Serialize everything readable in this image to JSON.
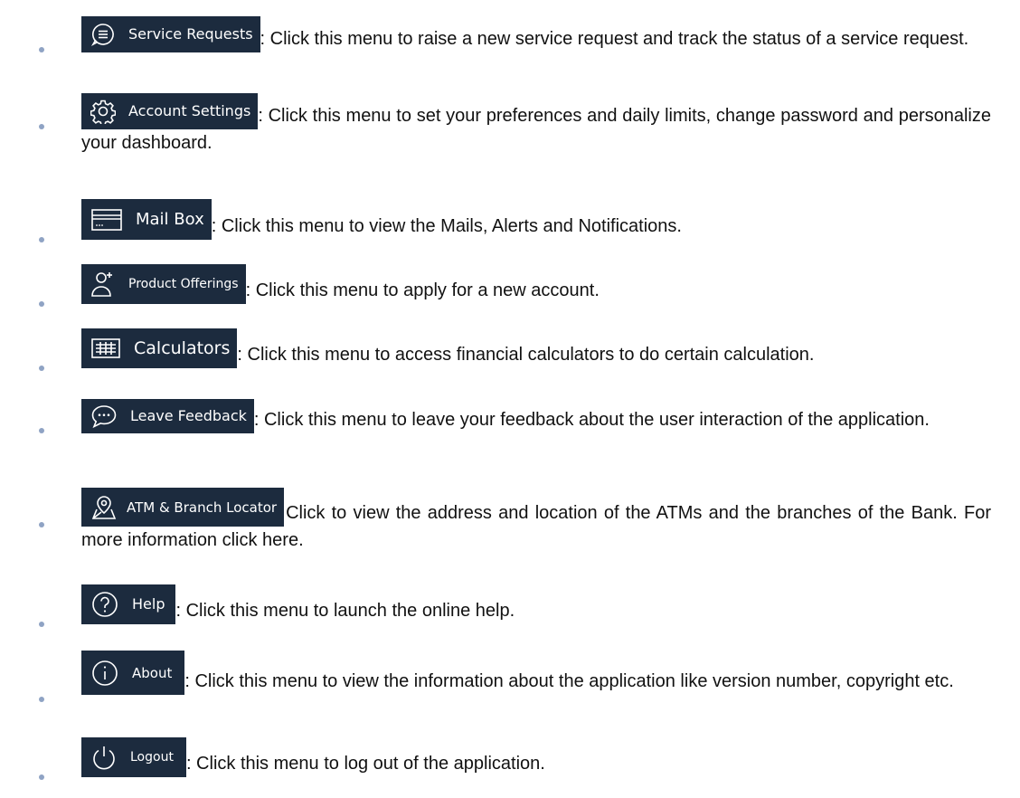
{
  "menu_items": [
    {
      "id": "service-requests",
      "label": "Service Requests",
      "icon": "chat-bubble-icon",
      "description": ": Click this menu to raise a new service request and track the status of a service request."
    },
    {
      "id": "account-settings",
      "label": "Account Settings",
      "icon": "gear-icon",
      "description": ": Click this menu to set your preferences and daily limits, change password and personalize your dashboard."
    },
    {
      "id": "mail-box",
      "label": "Mail Box",
      "icon": "mailbox-icon",
      "description": ": Click this menu to view the Mails, Alerts and Notifications."
    },
    {
      "id": "product-offerings",
      "label": "Product Offerings",
      "icon": "add-user-icon",
      "description": ": Click this menu to apply for a new account."
    },
    {
      "id": "calculators",
      "label": "Calculators",
      "icon": "calculator-icon",
      "description": ": Click this menu to access financial calculators to do certain calculation."
    },
    {
      "id": "leave-feedback",
      "label": "Leave Feedback",
      "icon": "feedback-icon",
      "description": ": Click this menu to leave your feedback about the user interaction of the application."
    },
    {
      "id": "atm-branch-locator",
      "label": "ATM & Branch Locator",
      "icon": "map-pin-icon",
      "description": "Click to view the address and location of the ATMs and the branches of the Bank. For more information click here."
    },
    {
      "id": "help",
      "label": "Help",
      "icon": "help-icon",
      "description": ": Click this menu to launch the online help."
    },
    {
      "id": "about",
      "label": "About",
      "icon": "info-icon",
      "description": ": Click this menu to view the information about the application like version number, copyright etc."
    },
    {
      "id": "logout",
      "label": "Logout",
      "icon": "power-icon",
      "description": ": Click this menu to log out of the application."
    }
  ],
  "colors": {
    "chip_background": "#1c2b3e",
    "chip_text": "#ffffff",
    "bullet": "#8fa3c4",
    "body_text": "#111111"
  }
}
